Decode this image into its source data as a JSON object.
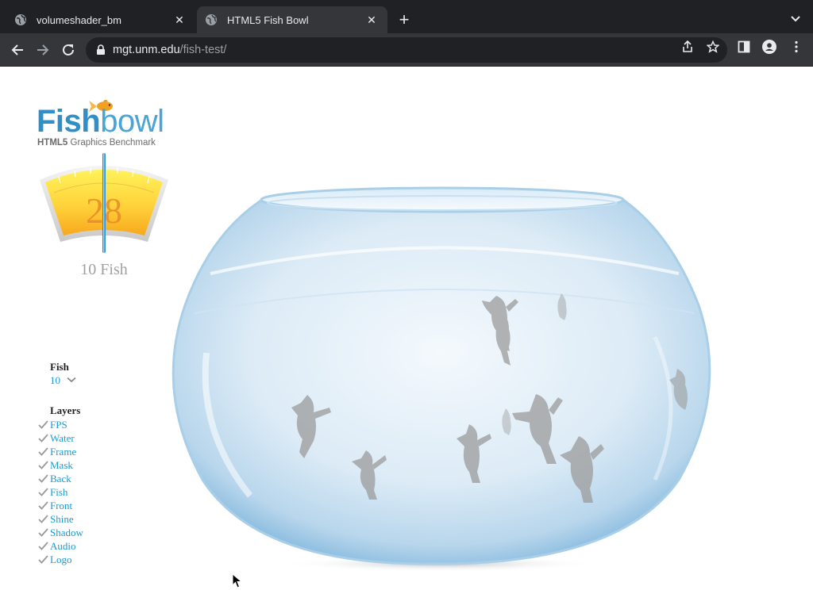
{
  "browser": {
    "tabs": [
      {
        "title": "volumeshader_bm",
        "active": false
      },
      {
        "title": "HTML5 Fish Bowl",
        "active": true
      }
    ],
    "new_tab_label": "+",
    "url_host": "mgt.unm.edu",
    "url_path": "/fish-test/"
  },
  "app": {
    "logo_fish_bold": "Fish",
    "logo_fish_light": "bowl",
    "logo_sub_bold": "HTML5",
    "logo_sub_rest": " Graphics Benchmark",
    "fps_value": "28",
    "fish_count_label": "10 Fish"
  },
  "controls": {
    "fish_heading": "Fish",
    "fish_selected": "10",
    "layers_heading": "Layers",
    "layers": [
      {
        "label": "FPS",
        "checked": true
      },
      {
        "label": "Water",
        "checked": true
      },
      {
        "label": "Frame",
        "checked": true
      },
      {
        "label": "Mask",
        "checked": true
      },
      {
        "label": "Back",
        "checked": true
      },
      {
        "label": "Fish",
        "checked": true
      },
      {
        "label": "Front",
        "checked": true
      },
      {
        "label": "Shine",
        "checked": true
      },
      {
        "label": "Shadow",
        "checked": true
      },
      {
        "label": "Audio",
        "checked": true
      },
      {
        "label": "Logo",
        "checked": true
      }
    ]
  },
  "colors": {
    "chrome_dark": "#202124",
    "chrome_toolbar": "#35363a",
    "link_blue": "#1a9bd2",
    "logo_blue": "#2f8fc6",
    "gauge_orange": "#e88a2a"
  },
  "icons": [
    "globe-icon",
    "close-icon",
    "plus-icon",
    "chevron-down-icon",
    "back-arrow-icon",
    "forward-arrow-icon",
    "reload-icon",
    "lock-icon",
    "share-icon",
    "star-icon",
    "sidepanel-icon",
    "profile-icon",
    "kebab-menu-icon",
    "checkmark-icon",
    "cursor-icon"
  ]
}
